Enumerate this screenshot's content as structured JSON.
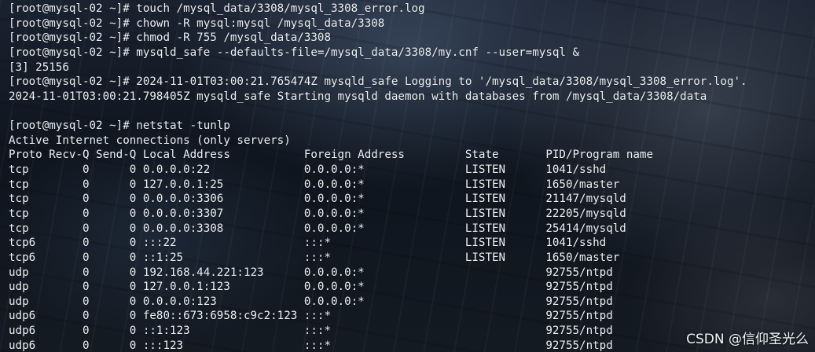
{
  "terminal": {
    "lines": [
      "[root@mysql-02 ~]# touch /mysql_data/3308/mysql_3308_error.log",
      "[root@mysql-02 ~]# chown -R mysql:mysql /mysql_data/3308",
      "[root@mysql-02 ~]# chmod -R 755 /mysql_data/3308",
      "[root@mysql-02 ~]# mysqld_safe --defaults-file=/mysql_data/3308/my.cnf --user=mysql &",
      "[3] 25156",
      "[root@mysql-02 ~]# 2024-11-01T03:00:21.765474Z mysqld_safe Logging to '/mysql_data/3308/mysql_3308_error.log'.",
      "2024-11-01T03:00:21.798405Z mysqld_safe Starting mysqld daemon with databases from /mysql_data/3308/data",
      "",
      "[root@mysql-02 ~]# netstat -tunlp",
      "Active Internet connections (only servers)",
      "Proto Recv-Q Send-Q Local Address           Foreign Address         State       PID/Program name",
      "tcp        0      0 0.0.0.0:22              0.0.0.0:*               LISTEN      1041/sshd",
      "tcp        0      0 127.0.0.1:25            0.0.0.0:*               LISTEN      1650/master",
      "tcp        0      0 0.0.0.0:3306            0.0.0.0:*               LISTEN      21147/mysqld",
      "tcp        0      0 0.0.0.0:3307            0.0.0.0:*               LISTEN      22205/mysqld",
      "tcp        0      0 0.0.0.0:3308            0.0.0.0:*               LISTEN      25414/mysqld",
      "tcp6       0      0 :::22                   :::*                    LISTEN      1041/sshd",
      "tcp6       0      0 ::1:25                  :::*                    LISTEN      1650/master",
      "udp        0      0 192.168.44.221:123      0.0.0.0:*                           92755/ntpd",
      "udp        0      0 127.0.0.1:123           0.0.0.0:*                           92755/ntpd",
      "udp        0      0 0.0.0.0:123             0.0.0.0:*                           92755/ntpd",
      "udp6       0      0 fe80::673:6958:c9c2:123 :::*                                92755/ntpd",
      "udp6       0      0 ::1:123                 :::*                                92755/ntpd",
      "udp6       0      0 :::123                  :::*                                92755/ntpd"
    ]
  },
  "watermark": "CSDN @信仰圣光么"
}
